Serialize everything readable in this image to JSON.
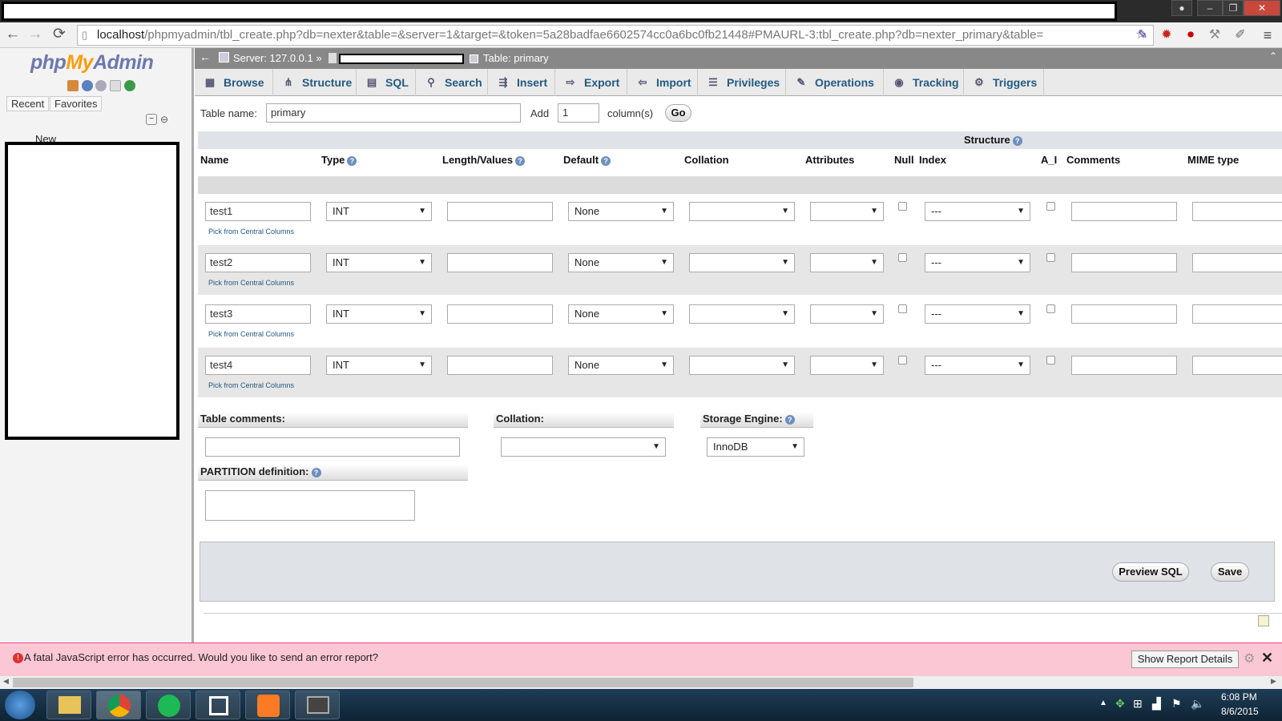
{
  "browser": {
    "url_host": "localhost",
    "url_path": "/phpmyadmin/tbl_create.php?db=nexter&table=&server=1&target=&token=5a28badfae6602574cc0a6bc0fb21448#PMAURL-3:tbl_create.php?db=nexter_primary&table="
  },
  "sidebar": {
    "logo_php": "php",
    "logo_my": "My",
    "logo_admin": "Admin",
    "recent": "Recent",
    "favorites": "Favorites",
    "new_label": "New"
  },
  "header": {
    "server": "Server: 127.0.0.1 »",
    "table": "Table: primary"
  },
  "tabs": [
    {
      "label": "Browse",
      "icon": "browse-icon"
    },
    {
      "label": "Structure",
      "icon": "structure-icon"
    },
    {
      "label": "SQL",
      "icon": "sql-icon"
    },
    {
      "label": "Search",
      "icon": "search-icon"
    },
    {
      "label": "Insert",
      "icon": "insert-icon"
    },
    {
      "label": "Export",
      "icon": "export-icon"
    },
    {
      "label": "Import",
      "icon": "import-icon"
    },
    {
      "label": "Privileges",
      "icon": "privileges-icon"
    },
    {
      "label": "Operations",
      "icon": "operations-icon"
    },
    {
      "label": "Tracking",
      "icon": "tracking-icon"
    },
    {
      "label": "Triggers",
      "icon": "triggers-icon"
    }
  ],
  "form": {
    "table_name_label": "Table name:",
    "table_name_value": "primary",
    "add_label": "Add",
    "add_value": "1",
    "columns_label": "column(s)",
    "go_label": "Go",
    "structure_label": "Structure"
  },
  "columns_header": [
    "Name",
    "Type",
    "Length/Values",
    "Default",
    "Collation",
    "Attributes",
    "Null",
    "Index",
    "A_I",
    "Comments",
    "MIME type"
  ],
  "rows": [
    {
      "name": "test1",
      "type": "INT",
      "default": "None",
      "index": "---",
      "pick": "Pick from Central Columns"
    },
    {
      "name": "test2",
      "type": "INT",
      "default": "None",
      "index": "---",
      "pick": "Pick from Central Columns"
    },
    {
      "name": "test3",
      "type": "INT",
      "default": "None",
      "index": "---",
      "pick": "Pick from Central Columns"
    },
    {
      "name": "test4",
      "type": "INT",
      "default": "None",
      "index": "---",
      "pick": "Pick from Central Columns"
    }
  ],
  "footer_form": {
    "table_comments": "Table comments:",
    "collation": "Collation:",
    "storage_engine": "Storage Engine:",
    "storage_engine_value": "InnoDB",
    "partition": "PARTITION definition:",
    "preview_sql": "Preview SQL",
    "save": "Save"
  },
  "error": {
    "message": "A fatal JavaScript error has occurred. Would you like to send an error report?",
    "details_button": "Show Report Details"
  },
  "taskbar": {
    "time": "6:08 PM",
    "date": "8/6/2015"
  },
  "colors": {
    "link": "#235a81",
    "error_bg": "#fbc7d4",
    "header_bg": "#888888"
  }
}
